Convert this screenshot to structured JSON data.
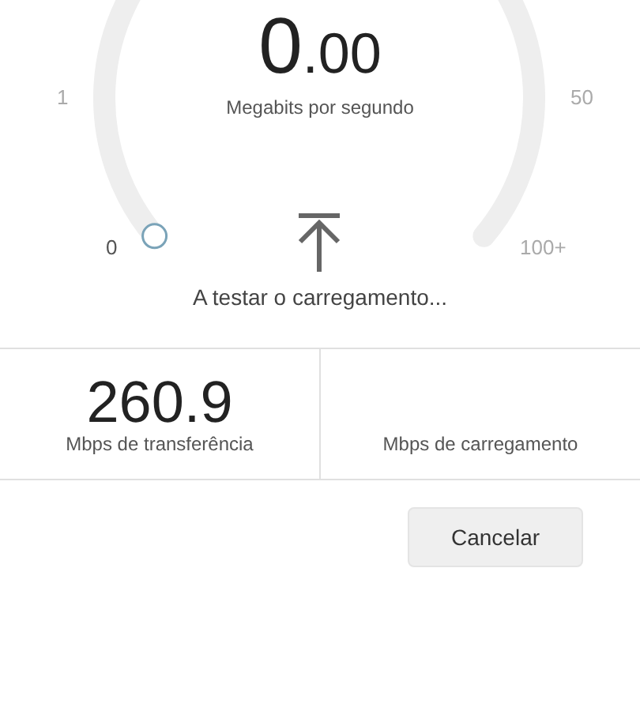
{
  "gauge": {
    "value_integer": "0",
    "value_decimals": ".00",
    "unit": "Megabits por segundo",
    "scale_labels": [
      "0",
      "1",
      "50",
      "100+"
    ]
  },
  "status": "A testar o carregamento...",
  "results": [
    {
      "value": "260.9",
      "label": "Mbps de transferência"
    },
    {
      "label": "Mbps de carregamento"
    }
  ],
  "buttons": [
    {
      "label": "Cancelar"
    }
  ]
}
